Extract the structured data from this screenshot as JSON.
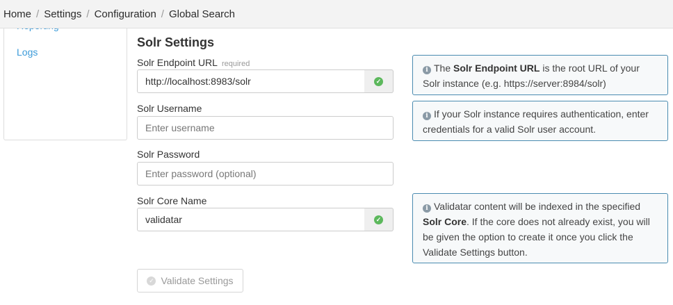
{
  "breadcrumb": {
    "items": [
      "Home",
      "Settings",
      "Configuration",
      "Global Search"
    ],
    "separator": "/"
  },
  "sidebar": {
    "items": [
      {
        "label": "Reporting"
      },
      {
        "label": "Logs"
      }
    ]
  },
  "section": {
    "title": "Solr Settings"
  },
  "fields": {
    "endpoint": {
      "label": "Solr Endpoint URL",
      "required_label": "required",
      "value": "http://localhost:8983/solr",
      "valid_icon": "check-circle-icon"
    },
    "username": {
      "label": "Solr Username",
      "placeholder": "Enter username",
      "value": ""
    },
    "password": {
      "label": "Solr Password",
      "placeholder": "Enter password (optional)",
      "value": ""
    },
    "core": {
      "label": "Solr Core Name",
      "value": "validatar",
      "valid_icon": "check-circle-icon"
    }
  },
  "info": {
    "endpoint": {
      "pre": "The ",
      "bold": "Solr Endpoint URL",
      "post": " is the root URL of your Solr instance (e.g. https://server:8984/solr)"
    },
    "auth": {
      "text": "If your Solr instance requires authentication, enter credentials for a valid Solr user account."
    },
    "core": {
      "pre": "Validatar content will be indexed in the specified ",
      "bold": "Solr Core",
      "post": ". If the core does not already exist, you will be given the option to create it once you click the Validate Settings button."
    }
  },
  "actions": {
    "validate_label": "Validate Settings"
  },
  "colors": {
    "link": "#3a9ad9",
    "success": "#5cb85c",
    "info_border": "#4a8bb0"
  }
}
